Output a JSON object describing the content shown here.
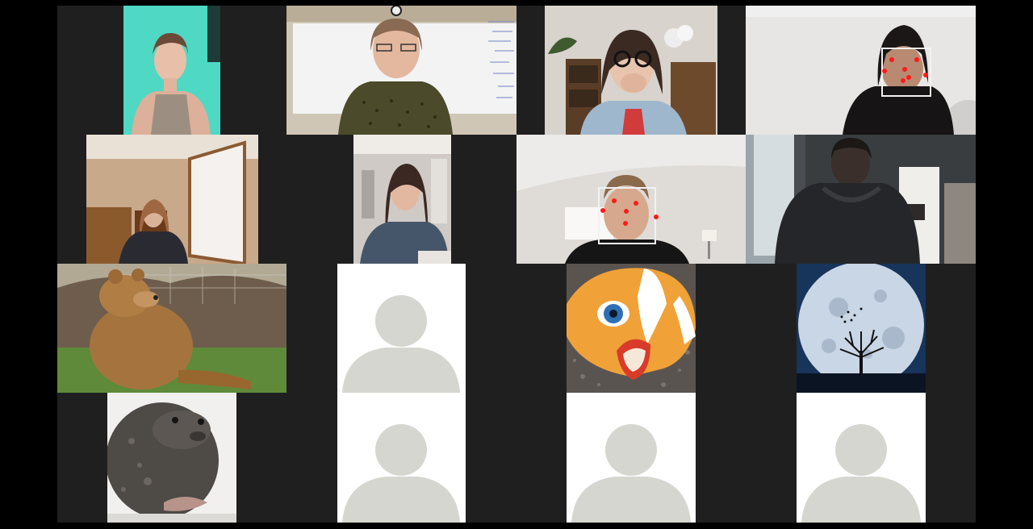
{
  "app": {
    "view": "gallery",
    "background_color": "#000000",
    "grid_color": "#1f1f1f"
  },
  "participants": [
    {
      "kind": "video",
      "scene": "girl-teal-wall-icon"
    },
    {
      "kind": "video",
      "scene": "teacher-whiteboard-icon"
    },
    {
      "kind": "video",
      "scene": "girl-glasses-bookshelf-icon"
    },
    {
      "kind": "video",
      "scene": "girl-face-tracking-icon",
      "face_tracking": true
    },
    {
      "kind": "video",
      "scene": "girl-bedroom-window-icon"
    },
    {
      "kind": "video",
      "scene": "girl-writing-icon"
    },
    {
      "kind": "video",
      "scene": "boy-face-tracking-icon",
      "face_tracking": true
    },
    {
      "kind": "video",
      "scene": "boy-hoodie-window-icon"
    },
    {
      "kind": "profile-image",
      "scene": "bear-sitting-icon"
    },
    {
      "kind": "avatar-placeholder",
      "scene": "person-silhouette-icon"
    },
    {
      "kind": "profile-image",
      "scene": "clownfish-plush-icon"
    },
    {
      "kind": "profile-image",
      "scene": "full-moon-tree-icon"
    },
    {
      "kind": "profile-image",
      "scene": "seal-icon"
    },
    {
      "kind": "avatar-placeholder",
      "scene": "person-silhouette-icon"
    },
    {
      "kind": "avatar-placeholder",
      "scene": "person-silhouette-icon"
    },
    {
      "kind": "avatar-placeholder",
      "scene": "person-silhouette-icon"
    }
  ],
  "face_tracking": {
    "box_color": "#f2f2f2",
    "dot_color": "#ff1a1a"
  }
}
